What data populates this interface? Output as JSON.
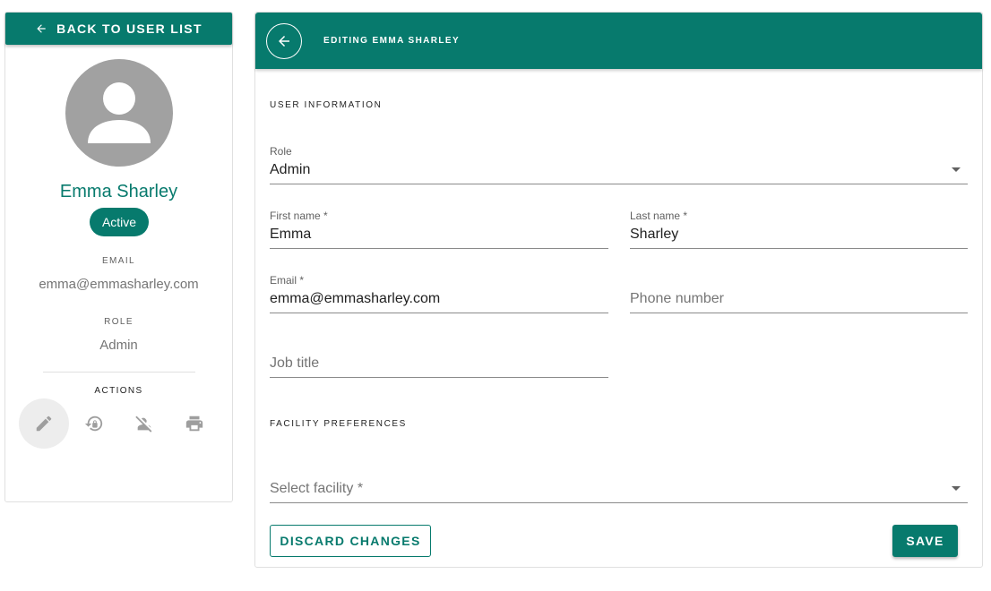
{
  "colors": {
    "accent": "#077a6d",
    "muted_icon": "#9e9e9e",
    "avatar_bg": "#a1a1a1"
  },
  "left_panel": {
    "back_label": "BACK TO USER LIST",
    "back_icon": "arrow-left-icon",
    "avatar_icon": "person-icon",
    "name": "Emma Sharley",
    "status": "Active",
    "email_label": "EMAIL",
    "email": "emma@emmasharley.com",
    "role_label": "ROLE",
    "role": "Admin",
    "actions_label": "ACTIONS",
    "actions": [
      {
        "icon": "pencil-icon",
        "active": true
      },
      {
        "icon": "lock-reset-icon",
        "active": false
      },
      {
        "icon": "person-off-icon",
        "active": false
      },
      {
        "icon": "printer-icon",
        "active": false
      }
    ]
  },
  "editor": {
    "title": "EDITING EMMA SHARLEY",
    "back_icon": "arrow-left-circle-icon",
    "user_info_title": "USER INFORMATION",
    "role": {
      "label": "Role",
      "value": "Admin"
    },
    "first_name": {
      "label": "First name *",
      "value": "Emma"
    },
    "last_name": {
      "label": "Last name *",
      "value": "Sharley"
    },
    "email": {
      "label": "Email *",
      "value": "emma@emmasharley.com"
    },
    "phone": {
      "placeholder": "Phone number"
    },
    "job_title": {
      "placeholder": "Job title"
    },
    "facility_title": "FACILITY PREFERENCES",
    "facility": {
      "placeholder": "Select facility *"
    },
    "discard_label": "DISCARD CHANGES",
    "save_label": "SAVE"
  }
}
